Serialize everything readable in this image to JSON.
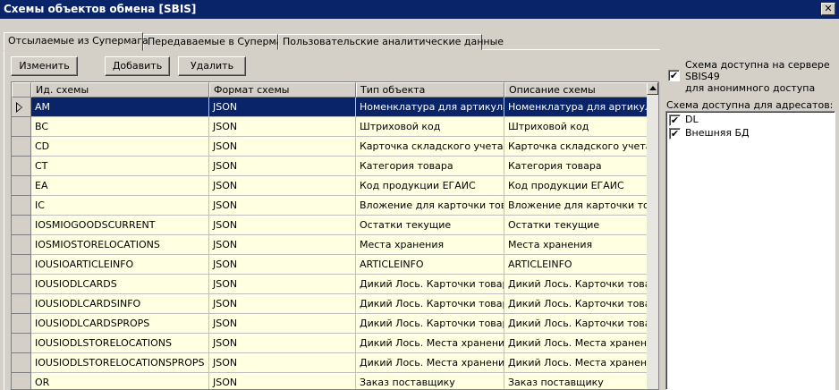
{
  "window": {
    "title": "Схемы объектов обмена [SBIS]",
    "close_glyph": "✕"
  },
  "tabs": [
    {
      "label": "Отсылаемые из Супермага"
    },
    {
      "label": "Передаваемые в Супермаг"
    },
    {
      "label": "Пользовательские аналитические данные"
    }
  ],
  "toolbar": {
    "edit": "Изменить",
    "add": "Добавить",
    "delete": "Удалить"
  },
  "grid": {
    "columns": [
      "Ид. схемы",
      "Формат схемы",
      "Тип объекта",
      "Описание схемы"
    ],
    "rows": [
      [
        "AM",
        "JSON",
        "Номенклатура для артикула",
        "Номенклатура для артикула"
      ],
      [
        "BC",
        "JSON",
        "Штриховой код",
        "Штриховой код"
      ],
      [
        "CD",
        "JSON",
        "Карточка складского учета",
        "Карточка складского учета"
      ],
      [
        "CT",
        "JSON",
        "Категория товара",
        "Категория товара"
      ],
      [
        "EA",
        "JSON",
        "Код продукции ЕГАИС",
        "Код продукции ЕГАИС"
      ],
      [
        "IC",
        "JSON",
        "Вложение для карточки товара",
        "Вложение для карточки товара"
      ],
      [
        "IOSMIOGOODSCURRENT",
        "JSON",
        "Остатки текущие",
        "Остатки текущие"
      ],
      [
        "IOSMIOSTORELOCATIONS",
        "JSON",
        "Места хранения",
        "Места хранения"
      ],
      [
        "IOUSIOARTICLEINFO",
        "JSON",
        "ARTICLEINFO",
        "ARTICLEINFO"
      ],
      [
        "IOUSIODLCARDS",
        "JSON",
        "Дикий Лось. Карточки товаров",
        "Дикий Лось. Карточки товаров"
      ],
      [
        "IOUSIODLCARDSINFO",
        "JSON",
        "Дикий Лось. Карточки товар...",
        "Дикий Лось. Карточки товаров"
      ],
      [
        "IOUSIODLCARDSPROPS",
        "JSON",
        "Дикий Лось. Карточки товар...",
        "Дикий Лось. Карточки товаров"
      ],
      [
        "IOUSIODLSTORELOCATIONS",
        "JSON",
        "Дикий Лось. Места хранения",
        "Дикий Лось. Места хранения"
      ],
      [
        "IOUSIODLSTORELOCATIONSPROPS",
        "JSON",
        "Дикий Лось. Места хранения...",
        "Дикий Лось. Места хранения."
      ],
      [
        "OR",
        "JSON",
        "Заказ поставщику",
        "Заказ поставщику"
      ]
    ]
  },
  "side": {
    "anon_line1": "Схема доступна на сервере",
    "anon_line2": "SBIS49",
    "anon_line3": "для анонимного доступа",
    "anon_checked": "✔",
    "recipients_label": "Схема доступна для адресатов:",
    "recipients": [
      {
        "label": "DL",
        "check": "✔"
      },
      {
        "label": "Внешняя БД",
        "check": "✔"
      }
    ]
  }
}
